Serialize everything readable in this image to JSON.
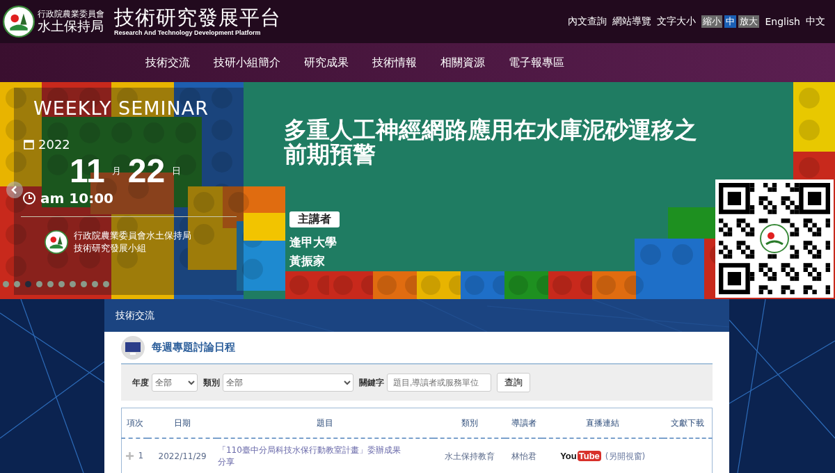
{
  "header": {
    "agency_lines": [
      "行政院農業委員會",
      "水土保持局"
    ],
    "title": "技術研究發展平台",
    "subtitle": "Research And Technology Development Platform",
    "links": [
      {
        "label": "內文查詢",
        "kind": "link"
      },
      {
        "label": "網站導覽",
        "kind": "link"
      },
      {
        "label": "文字大小",
        "kind": "label"
      },
      {
        "label": "縮小",
        "kind": "size",
        "selected": false
      },
      {
        "label": "中",
        "kind": "size",
        "selected": true
      },
      {
        "label": "放大",
        "kind": "size",
        "selected": false
      },
      {
        "label": "English",
        "kind": "link"
      },
      {
        "label": "中文",
        "kind": "link"
      }
    ]
  },
  "nav": {
    "items": [
      "技術交流",
      "技研小組簡介",
      "研究成果",
      "技術情報",
      "相關資源",
      "電子報專區"
    ]
  },
  "banner": {
    "heading": "WEEKLY SEMINAR",
    "year": "2022",
    "month": "11",
    "month_unit": "月",
    "day": "22",
    "day_unit": "日",
    "time": "am 10:00",
    "org_lines": [
      "行政院農業委員會水土保持局",
      "技術研究發展小組"
    ],
    "topic_lines": [
      "多重人工神經網路應用在水庫泥砂運移之",
      "前期預警"
    ],
    "speaker_tag": "主講者",
    "speaker_lines": [
      "逢甲大學",
      "黃振家"
    ],
    "dots": [
      {
        "selected": false
      },
      {
        "selected": false
      },
      {
        "selected": true
      },
      {
        "selected": false
      },
      {
        "selected": false
      },
      {
        "selected": false
      },
      {
        "selected": false
      },
      {
        "selected": false
      },
      {
        "selected": false
      },
      {
        "selected": false
      }
    ]
  },
  "section": {
    "title": "技術交流",
    "heading": "每週專題討論日程",
    "filters": [
      {
        "label": "年度",
        "kind": "select",
        "value": "全部"
      },
      {
        "label": "類別",
        "kind": "select",
        "value": "全部"
      },
      {
        "label": "關鍵字",
        "kind": "text",
        "placeholder": "題目,導讀者或服務單位"
      }
    ],
    "search_button": "查詢",
    "table": {
      "columns": [
        "項次",
        "日期",
        "題目",
        "類別",
        "導讀者",
        "直播連結",
        "文獻下載"
      ],
      "rows": [
        {
          "index": "1",
          "date": "2022/11/29",
          "title": "「110臺中分局科技水保行動教室計畫」委辦成果分享",
          "category": "水土保持教育",
          "reader": "林怡君",
          "live_logo": [
            "You",
            "Tube"
          ],
          "live_note": "(另開視窗)"
        }
      ]
    }
  }
}
